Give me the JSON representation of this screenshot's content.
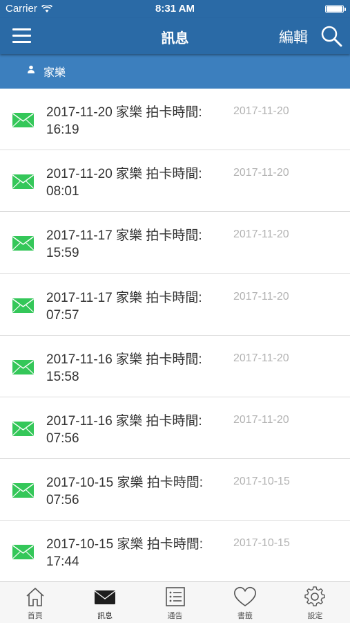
{
  "status_bar": {
    "carrier": "Carrier",
    "time": "8:31 AM"
  },
  "nav": {
    "title": "訊息",
    "edit_label": "編輯",
    "menu_icon": "hamburger-menu-icon",
    "search_icon": "search-icon"
  },
  "section": {
    "name": "家樂",
    "icon": "person-icon"
  },
  "messages": [
    {
      "text": "2017-11-20 家樂 拍卡時間:\n16:19",
      "date": "2017-11-20"
    },
    {
      "text": "2017-11-20 家樂 拍卡時間:\n08:01",
      "date": "2017-11-20"
    },
    {
      "text": "2017-11-17 家樂 拍卡時間:\n15:59",
      "date": "2017-11-20"
    },
    {
      "text": "2017-11-17 家樂 拍卡時間:\n07:57",
      "date": "2017-11-20"
    },
    {
      "text": "2017-11-16 家樂 拍卡時間:\n15:58",
      "date": "2017-11-20"
    },
    {
      "text": "2017-11-16 家樂 拍卡時間:\n07:56",
      "date": "2017-11-20"
    },
    {
      "text": "2017-10-15 家樂 拍卡時間:\n07:56",
      "date": "2017-10-15"
    },
    {
      "text": "2017-10-15 家樂 拍卡時間:\n17:44",
      "date": "2017-10-15"
    }
  ],
  "tabs": [
    {
      "label": "首頁",
      "icon": "home-icon"
    },
    {
      "label": "訊息",
      "icon": "envelope-icon",
      "active": true
    },
    {
      "label": "通告",
      "icon": "list-icon"
    },
    {
      "label": "書籤",
      "icon": "heart-icon"
    },
    {
      "label": "設定",
      "icon": "gear-icon"
    }
  ],
  "colors": {
    "nav_bg": "#2a6aa6",
    "section_bg": "#3c7fbe",
    "envelope_green": "#34c759",
    "date_gray": "#b3b3b3"
  }
}
